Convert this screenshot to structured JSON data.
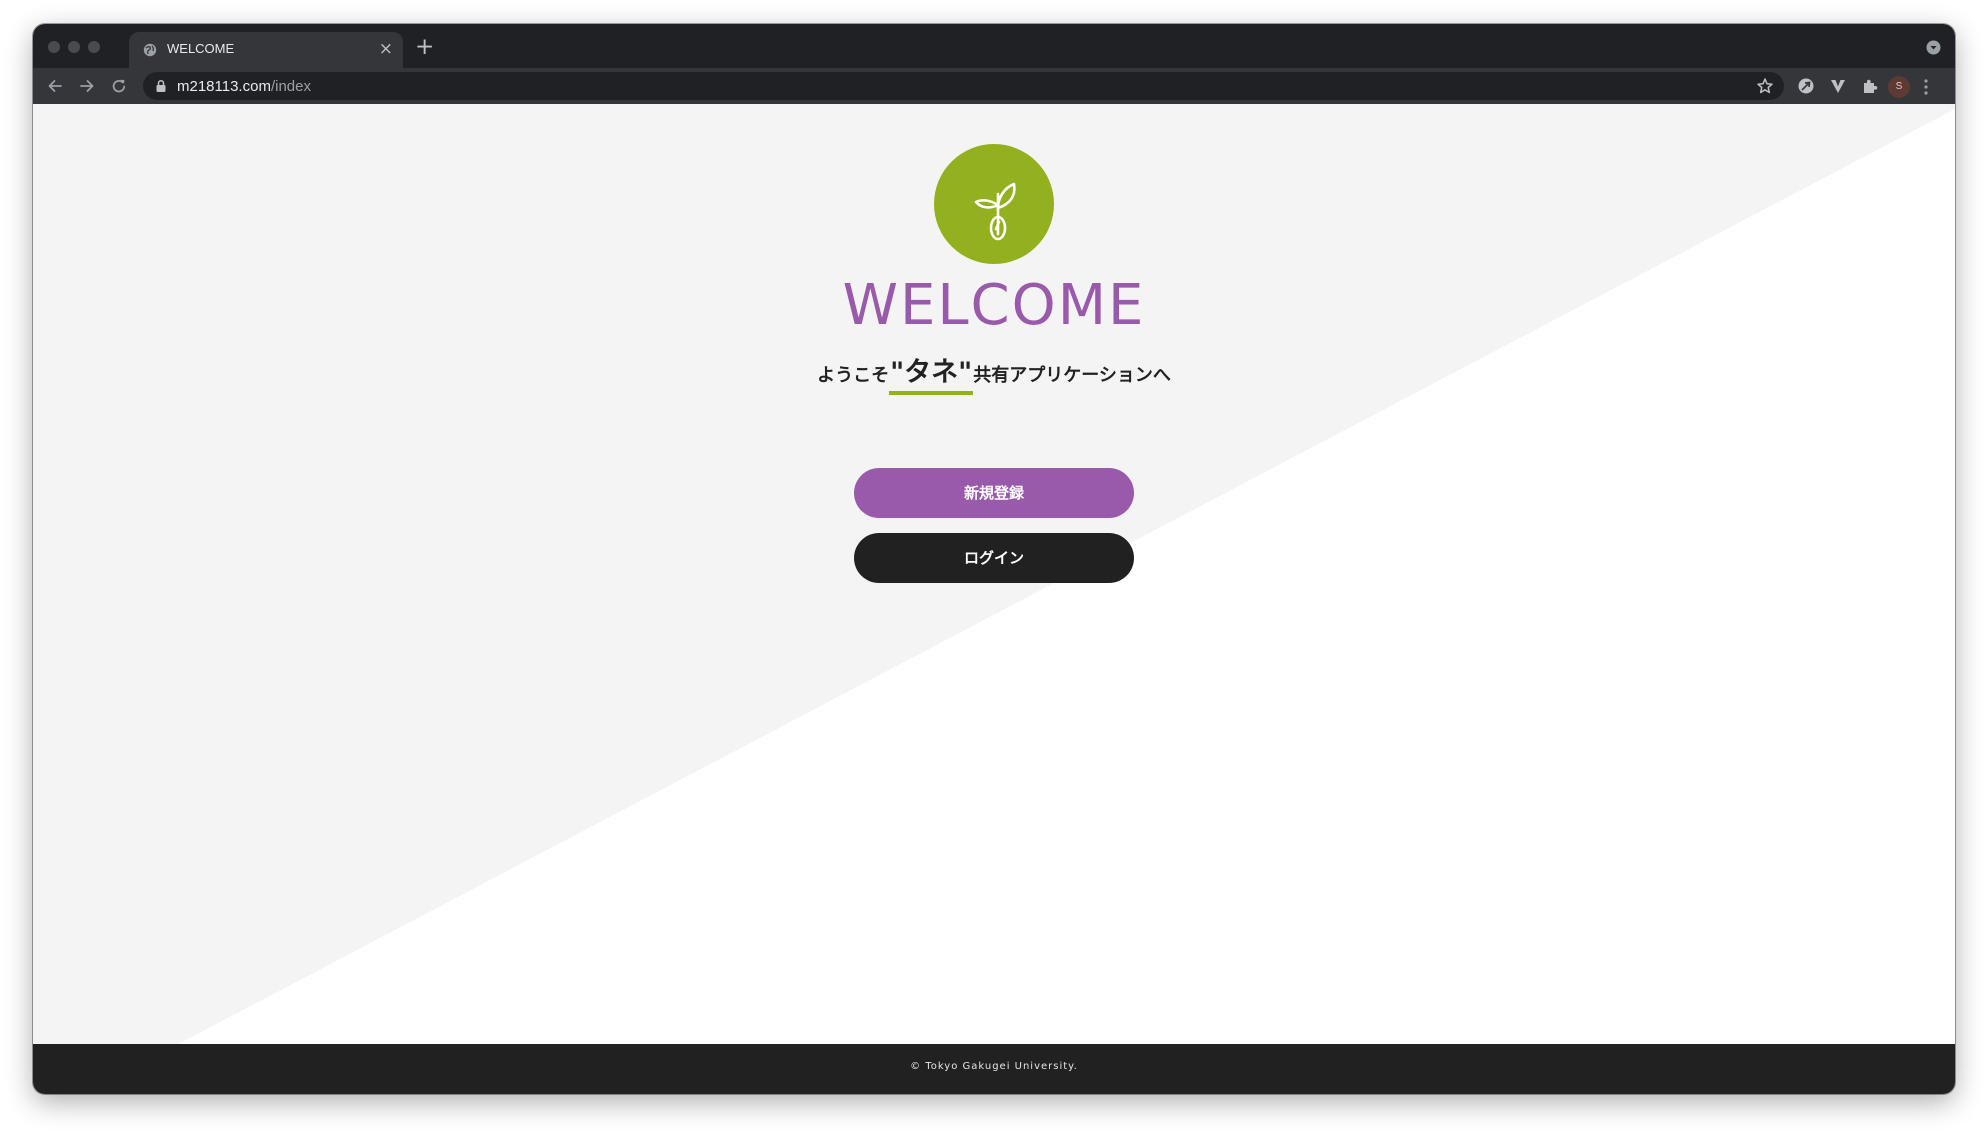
{
  "browser": {
    "tab": {
      "title": "WELCOME",
      "close_glyph": "×",
      "favicon": "globe-icon"
    },
    "new_tab_glyph": "+",
    "address": {
      "host": "m218113.com",
      "path": "/index"
    },
    "profile_initial": "S",
    "icons": [
      "back-icon",
      "forward-icon",
      "reload-icon",
      "lock-icon",
      "star-icon",
      "extension-icon",
      "puzzle-icon",
      "menu-icon",
      "tab-search-icon"
    ]
  },
  "page": {
    "heading": "WELCOME",
    "tagline": {
      "prefix": "ようこそ",
      "highlight": "\"タネ\"",
      "suffix": "共有アプリケーションへ"
    },
    "buttons": {
      "register": "新規登録",
      "login": "ログイン"
    },
    "footer": "© Tokyo Gakugei University."
  },
  "colors": {
    "accent_purple": "#9a5aac",
    "accent_green": "#93b01e",
    "dark": "#212121",
    "background_gray": "#f4f4f4"
  }
}
